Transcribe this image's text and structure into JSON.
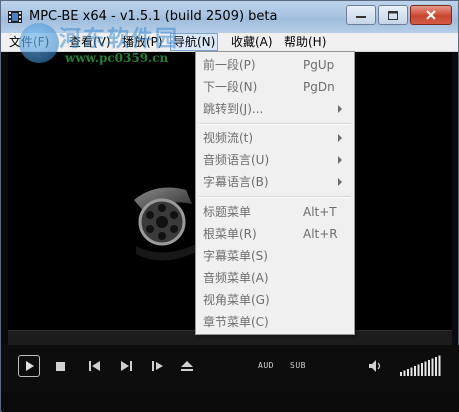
{
  "window": {
    "title": "MPC-BE x64 - v1.5.1 (build 2509) beta"
  },
  "menubar": {
    "items": [
      {
        "label": "文件(F)"
      },
      {
        "label": "查看(V)"
      },
      {
        "label": "播放(P)"
      },
      {
        "label": "导航(N)",
        "active": true
      },
      {
        "label": "收藏(A)"
      },
      {
        "label": "帮助(H)"
      }
    ]
  },
  "watermark": {
    "text": "河东软件园",
    "url": "www.pc0359.cn"
  },
  "navigation_menu": {
    "items": [
      {
        "label": "前一段(P)",
        "shortcut": "PgUp"
      },
      {
        "label": "下一段(N)",
        "shortcut": "PgDn"
      },
      {
        "label": "跳转到(J)...",
        "submenu": true
      },
      {
        "label": "视频流(t)",
        "submenu": true
      },
      {
        "label": "音频语言(U)",
        "submenu": true
      },
      {
        "label": "字幕语言(B)",
        "submenu": true
      },
      {
        "label": "标题菜单",
        "shortcut": "Alt+T"
      },
      {
        "label": "根菜单(R)",
        "shortcut": "Alt+R"
      },
      {
        "label": "字幕菜单(S)"
      },
      {
        "label": "音频菜单(A)"
      },
      {
        "label": "视角菜单(G)"
      },
      {
        "label": "章节菜单(C)"
      }
    ]
  },
  "controls": {
    "audio_label": "AUD",
    "subtitle_label": "SUB",
    "volume_level": 1.0
  },
  "icons": {
    "play": "play-icon",
    "stop": "stop-icon",
    "previous": "skip-previous-icon",
    "next": "skip-next-icon",
    "frame_step": "frame-step-icon",
    "eject": "eject-icon",
    "volume": "speaker-icon"
  },
  "colors": {
    "player_background": "#000000",
    "menu_background": "#f0f0f0",
    "disabled_text": "#6d6d6d",
    "watermark_url": "#28963c"
  }
}
